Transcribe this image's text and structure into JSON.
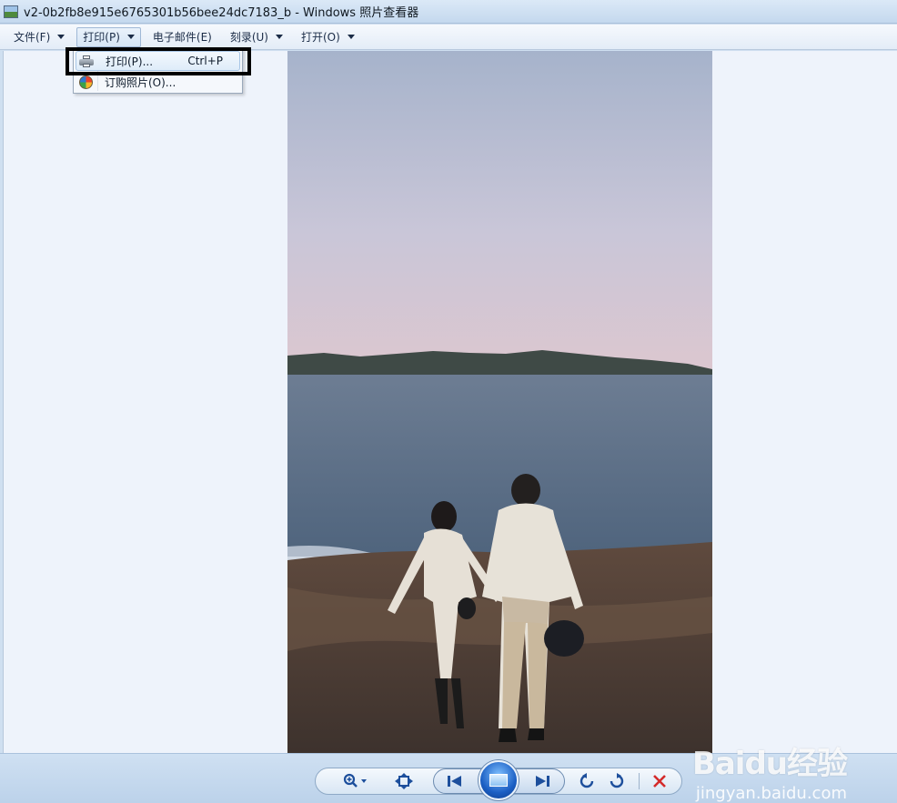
{
  "window": {
    "title": "v2-0b2fb8e915e6765301b56bee24dc7183_b - Windows 照片查看器",
    "icon": "photo-viewer-icon"
  },
  "menubar": {
    "items": [
      {
        "label": "文件(F)"
      },
      {
        "label": "打印(P)"
      },
      {
        "label": "电子邮件(E)"
      },
      {
        "label": "刻录(U)"
      },
      {
        "label": "打开(O)"
      }
    ]
  },
  "dropdown": {
    "items": [
      {
        "label": "打印(P)...",
        "shortcut": "Ctrl+P",
        "icon": "printer-icon"
      },
      {
        "label": "订购照片(O)...",
        "shortcut": "",
        "icon": "order-prints-icon"
      }
    ],
    "highlight_color": "#000000"
  },
  "controls": {
    "icons": [
      "zoom-icon",
      "actual-size-icon",
      "previous-icon",
      "slideshow-icon",
      "next-icon",
      "rotate-counterclockwise-icon",
      "rotate-clockwise-icon",
      "delete-icon"
    ],
    "delete_color": "#d42a2a"
  },
  "watermark": {
    "logo_text": "Baidu经验",
    "url": "jingyan.baidu.com"
  }
}
